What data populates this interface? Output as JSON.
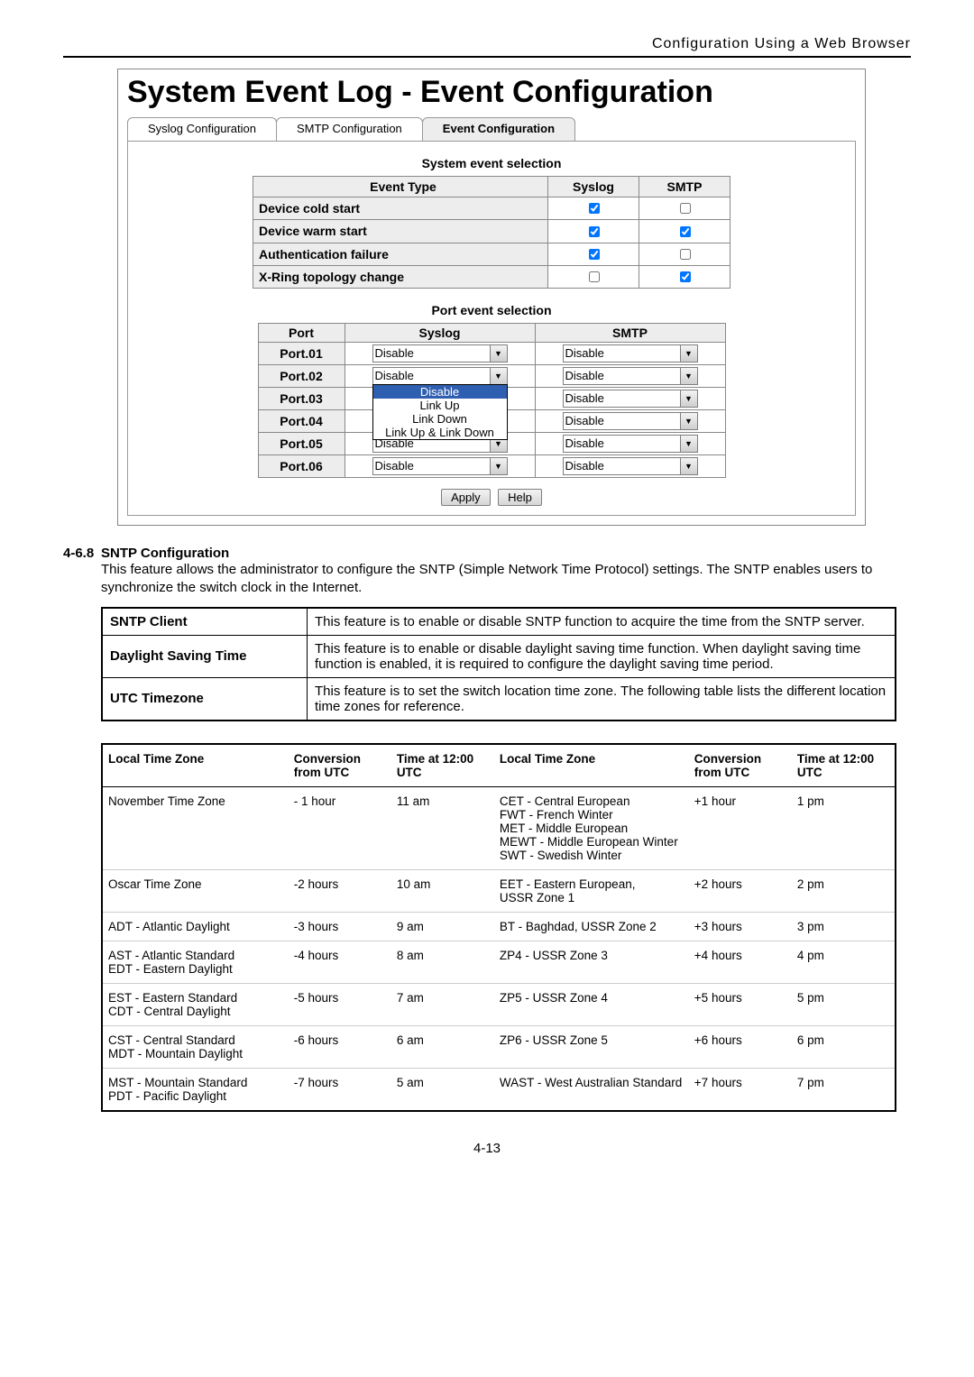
{
  "header": "Configuration  Using  a  Web  Browser",
  "screenshot": {
    "page_title": "System Event Log - Event Configuration",
    "tabs": [
      {
        "label": "Syslog Configuration",
        "active": false
      },
      {
        "label": "SMTP Configuration",
        "active": false
      },
      {
        "label": "Event Configuration",
        "active": true
      }
    ],
    "sys_section_title": "System event selection",
    "sys_headers": {
      "evt": "Event Type",
      "sys": "Syslog",
      "smtp": "SMTP"
    },
    "sys_rows": [
      {
        "label": "Device cold start",
        "syslog": true,
        "smtp": false
      },
      {
        "label": "Device warm start",
        "syslog": true,
        "smtp": true
      },
      {
        "label": "Authentication failure",
        "syslog": true,
        "smtp": false
      },
      {
        "label": "X-Ring topology change",
        "syslog": false,
        "smtp": true
      }
    ],
    "port_section_title": "Port event selection",
    "port_headers": {
      "port": "Port",
      "sys": "Syslog",
      "smtp": "SMTP"
    },
    "port_rows": [
      {
        "port": "Port.01",
        "syslog": "Disable",
        "smtp": "Disable"
      },
      {
        "port": "Port.02",
        "syslog": "Disable",
        "smtp": "Disable",
        "open": true
      },
      {
        "port": "Port.03",
        "syslog": "Disable",
        "smtp": "Disable"
      },
      {
        "port": "Port.04",
        "syslog": "Disable",
        "smtp": "Disable"
      },
      {
        "port": "Port.05",
        "syslog": "Disable",
        "smtp": "Disable"
      },
      {
        "port": "Port.06",
        "syslog": "Disable",
        "smtp": "Disable"
      }
    ],
    "syslog_options": [
      "Disable",
      "Link Up",
      "Link Down",
      "Link Up & Link Down"
    ],
    "buttons": {
      "apply": "Apply",
      "help": "Help"
    }
  },
  "sntp": {
    "heading_num": "4-6.8",
    "heading": "SNTP Configuration",
    "intro": "This feature allows the administrator to configure the SNTP (Simple Network Time Protocol) settings. The SNTP enables users to synchronize the switch clock in the Internet.",
    "rows": [
      {
        "term": "SNTP Client",
        "desc": "This feature is to enable or disable SNTP function to acquire the time from the SNTP server."
      },
      {
        "term": "Daylight Saving Time",
        "desc": "This feature is to enable or disable daylight saving time function. When daylight saving time function is enabled, it is required to configure the daylight saving time period."
      },
      {
        "term": "UTC Timezone",
        "desc": "This feature is to set the switch location time zone. The following table lists the different location time zones for reference."
      }
    ]
  },
  "tz": {
    "headers": [
      "Local Time Zone",
      "Conversion from UTC",
      "Time at 12:00 UTC",
      "Local Time Zone",
      "Conversion from UTC",
      "Time at 12:00 UTC"
    ],
    "rows": [
      [
        "November Time Zone",
        "- 1 hour",
        "11 am",
        "CET - Central European\nFWT - French Winter\nMET - Middle European\nMEWT - Middle European Winter\nSWT - Swedish Winter",
        "+1 hour",
        "1 pm"
      ],
      [
        "Oscar Time Zone",
        "-2 hours",
        "10 am",
        "EET - Eastern European,\nUSSR Zone 1",
        "+2 hours",
        "2 pm"
      ],
      [
        "ADT - Atlantic Daylight",
        "-3 hours",
        "9 am",
        "BT - Baghdad, USSR Zone 2",
        "+3 hours",
        "3 pm"
      ],
      [
        "AST - Atlantic Standard\nEDT - Eastern Daylight",
        "-4 hours",
        "8 am",
        "ZP4 - USSR Zone 3",
        "+4 hours",
        "4 pm"
      ],
      [
        "EST - Eastern Standard\nCDT - Central Daylight",
        "-5 hours",
        "7 am",
        "ZP5 - USSR Zone 4",
        "+5 hours",
        "5 pm"
      ],
      [
        "CST - Central Standard\nMDT - Mountain Daylight",
        "-6 hours",
        "6 am",
        "ZP6 - USSR Zone 5",
        "+6 hours",
        "6 pm"
      ],
      [
        "MST - Mountain Standard\nPDT - Pacific Daylight",
        "-7 hours",
        "5 am",
        "WAST - West Australian Standard",
        "+7 hours",
        "7 pm"
      ]
    ]
  },
  "page_num": "4-13"
}
